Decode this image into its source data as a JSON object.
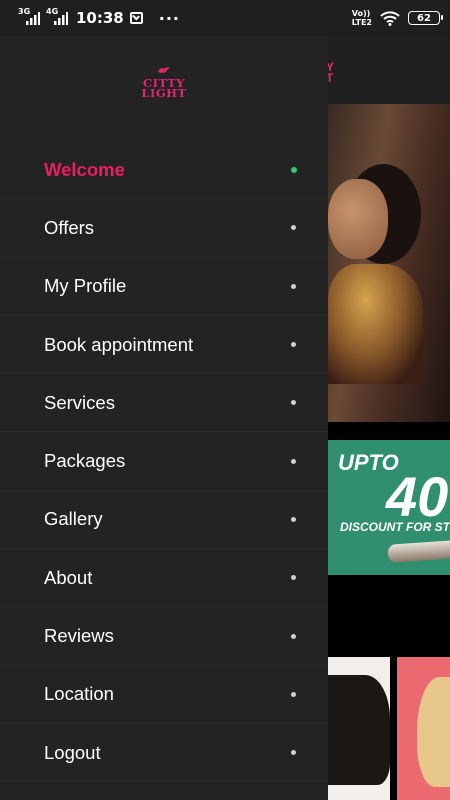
{
  "status_bar": {
    "network_1": "3G",
    "network_2": "4G",
    "time": "10:38",
    "more": "···",
    "volte": "Vo))",
    "lte": "LTE2",
    "battery": "62"
  },
  "drawer": {
    "logo_line1": "CITTY",
    "logo_line2": "LIGHT",
    "items": [
      {
        "label": "Welcome",
        "active": true
      },
      {
        "label": "Offers",
        "active": false
      },
      {
        "label": "My Profile",
        "active": false
      },
      {
        "label": "Book appointment",
        "active": false
      },
      {
        "label": "Services",
        "active": false
      },
      {
        "label": "Packages",
        "active": false
      },
      {
        "label": "Gallery",
        "active": false
      },
      {
        "label": "About",
        "active": false
      },
      {
        "label": "Reviews",
        "active": false
      },
      {
        "label": "Location",
        "active": false
      },
      {
        "label": "Logout",
        "active": false
      }
    ]
  },
  "background": {
    "header_logo": "Y\nT",
    "promo_upto": "UPTO",
    "promo_value": "40",
    "promo_text": "DISCOUNT FOR ST"
  },
  "colors": {
    "accent": "#e91e63",
    "active_dot": "#2ecc71",
    "drawer_bg": "#232323",
    "status_bg": "#1f1f1f"
  }
}
